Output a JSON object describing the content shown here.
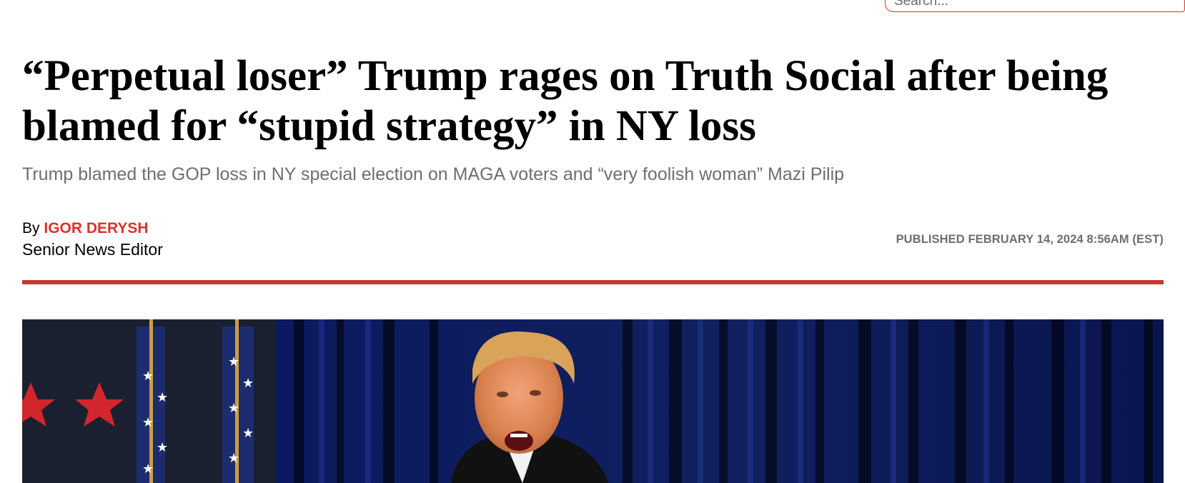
{
  "search": {
    "placeholder": "Search..."
  },
  "article": {
    "headline": "“Perpetual loser” Trump rages on Truth Social after being blamed for “stupid strategy” in NY loss",
    "subhead": "Trump blamed the GOP loss in NY special election on MAGA voters and “very foolish woman” Mazi Pilip",
    "byline_prefix": "By",
    "author": "IGOR DERYSH",
    "author_title": "Senior News Editor",
    "published": "PUBLISHED FEBRUARY 14, 2024 8:56AM (EST)"
  },
  "colors": {
    "accent": "#d9332b",
    "rule": "#c8362f",
    "muted_text": "#6e6e6e"
  },
  "hero_image": {
    "subject": "photo-trump-speaking-flags-blue-curtain"
  }
}
